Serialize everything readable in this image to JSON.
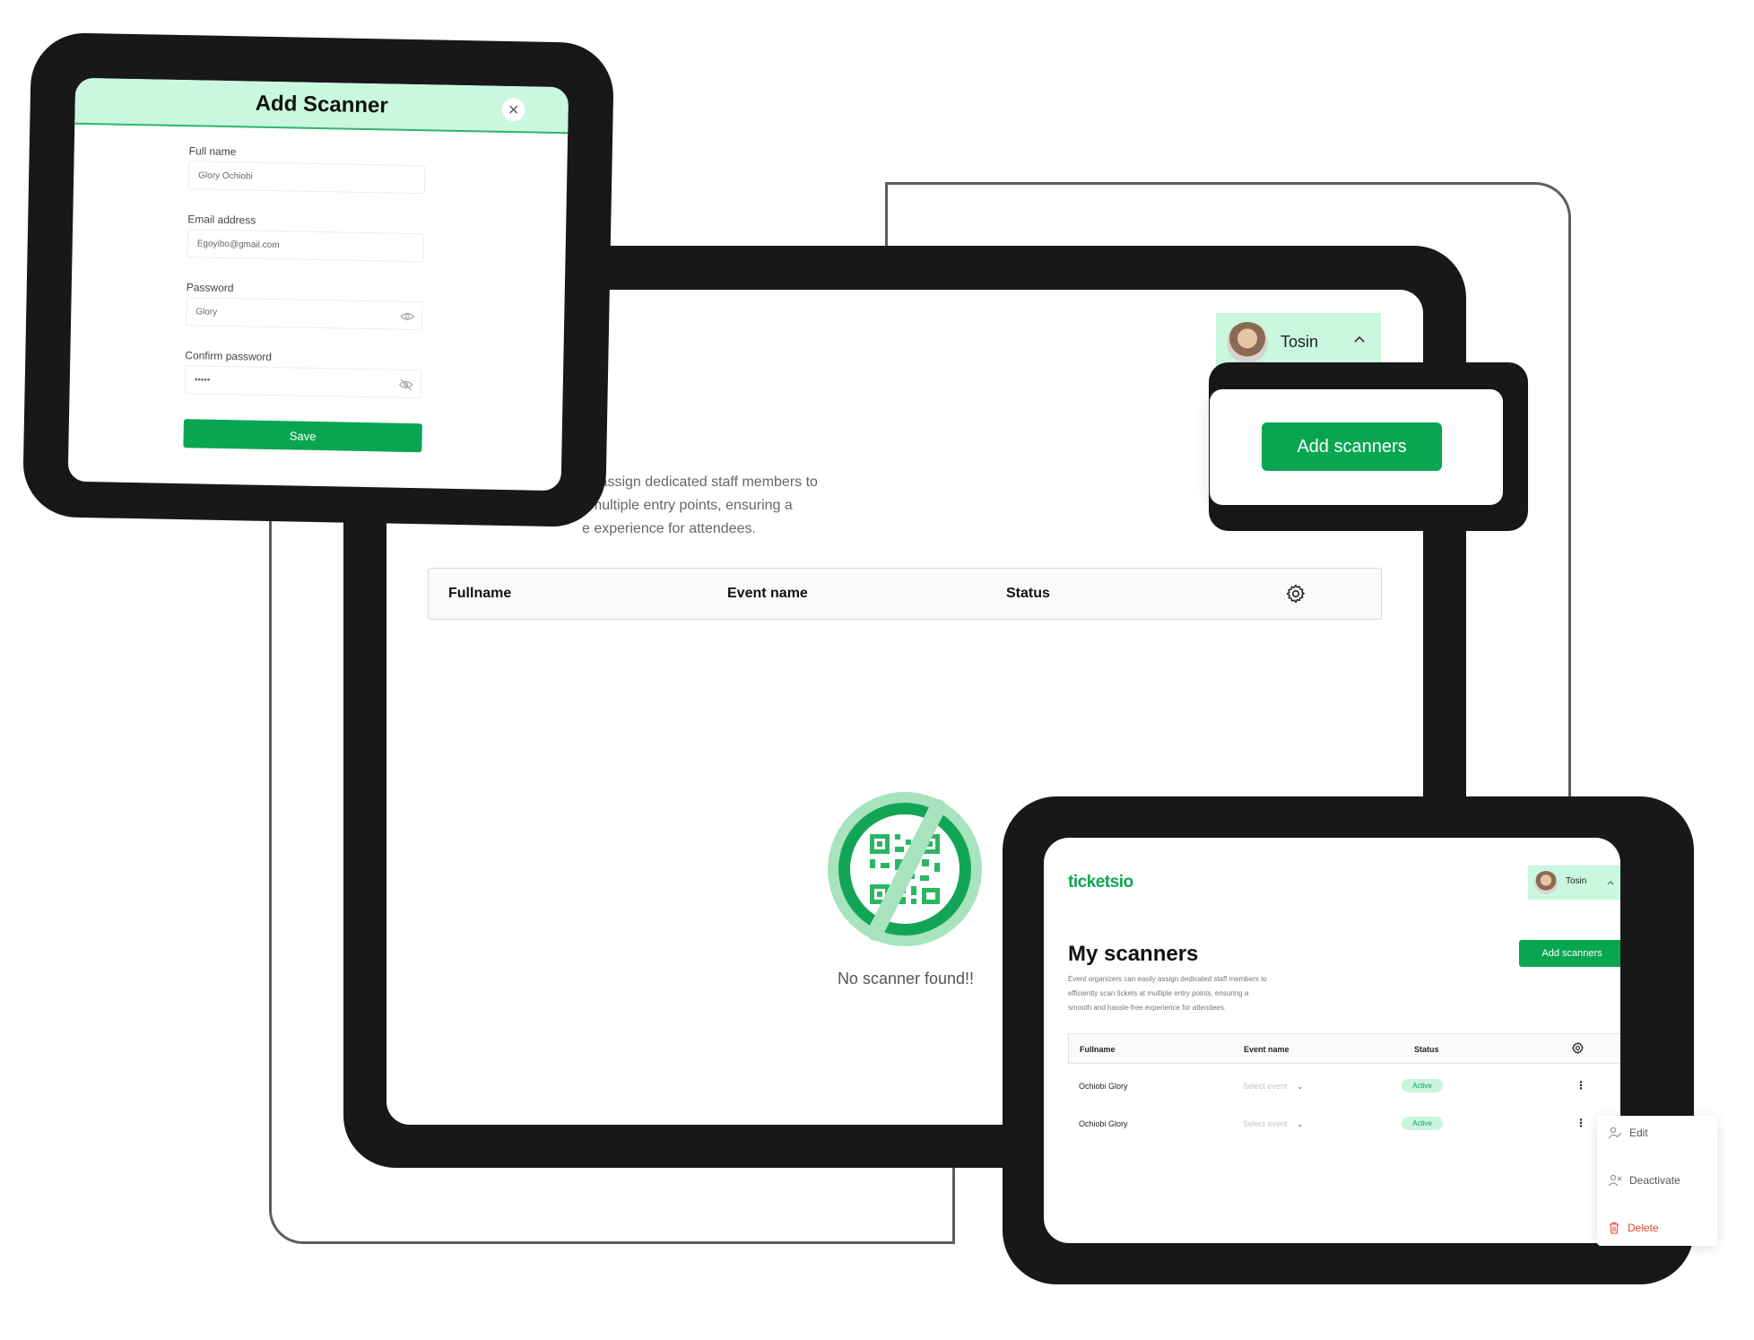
{
  "add_scanner_modal": {
    "title": "Add Scanner",
    "fields": [
      {
        "label": "Full name",
        "value": "Glory Ochiobi"
      },
      {
        "label": "Email address",
        "value": "Egoyibo@gmail.com"
      },
      {
        "label": "Password",
        "value": "Glory"
      },
      {
        "label": "Confirm password",
        "value": "•••••"
      }
    ],
    "save_label": "Save"
  },
  "main_screen": {
    "user_name": "Tosin",
    "add_button_label": "Add scanners",
    "description_lines": [
      "ily assign dedicated staff members to",
      "t multiple entry points, ensuring a",
      "e experience for attendees."
    ],
    "table_headers": [
      "Fullname",
      "Event name",
      "Status"
    ],
    "empty_state_text": "No scanner found!!"
  },
  "small_screen": {
    "logo": "ticketsio",
    "user_name": "Tosin",
    "page_title": "My scanners",
    "add_button_label": "Add scanners",
    "description": [
      "Event organizers can easily assign dedicated staff members to",
      "efficiently scan tickets at multiple entry points, ensuring a",
      "smooth and hassle-free experience for attendees."
    ],
    "table_headers": [
      "Fullname",
      "Event name",
      "Status"
    ],
    "rows": [
      {
        "name": "Ochiobi Glory",
        "event_placeholder": "Select event",
        "status": "Active"
      },
      {
        "name": "Ochiobi Glory",
        "event_placeholder": "Select event",
        "status": "Active"
      }
    ],
    "context_menu": {
      "edit": "Edit",
      "deactivate": "Deactivate",
      "delete": "Delete"
    }
  },
  "colors": {
    "brand_green": "#08a651",
    "mint": "#c9f7df",
    "frame": "#181818",
    "danger": "#e5452f"
  }
}
